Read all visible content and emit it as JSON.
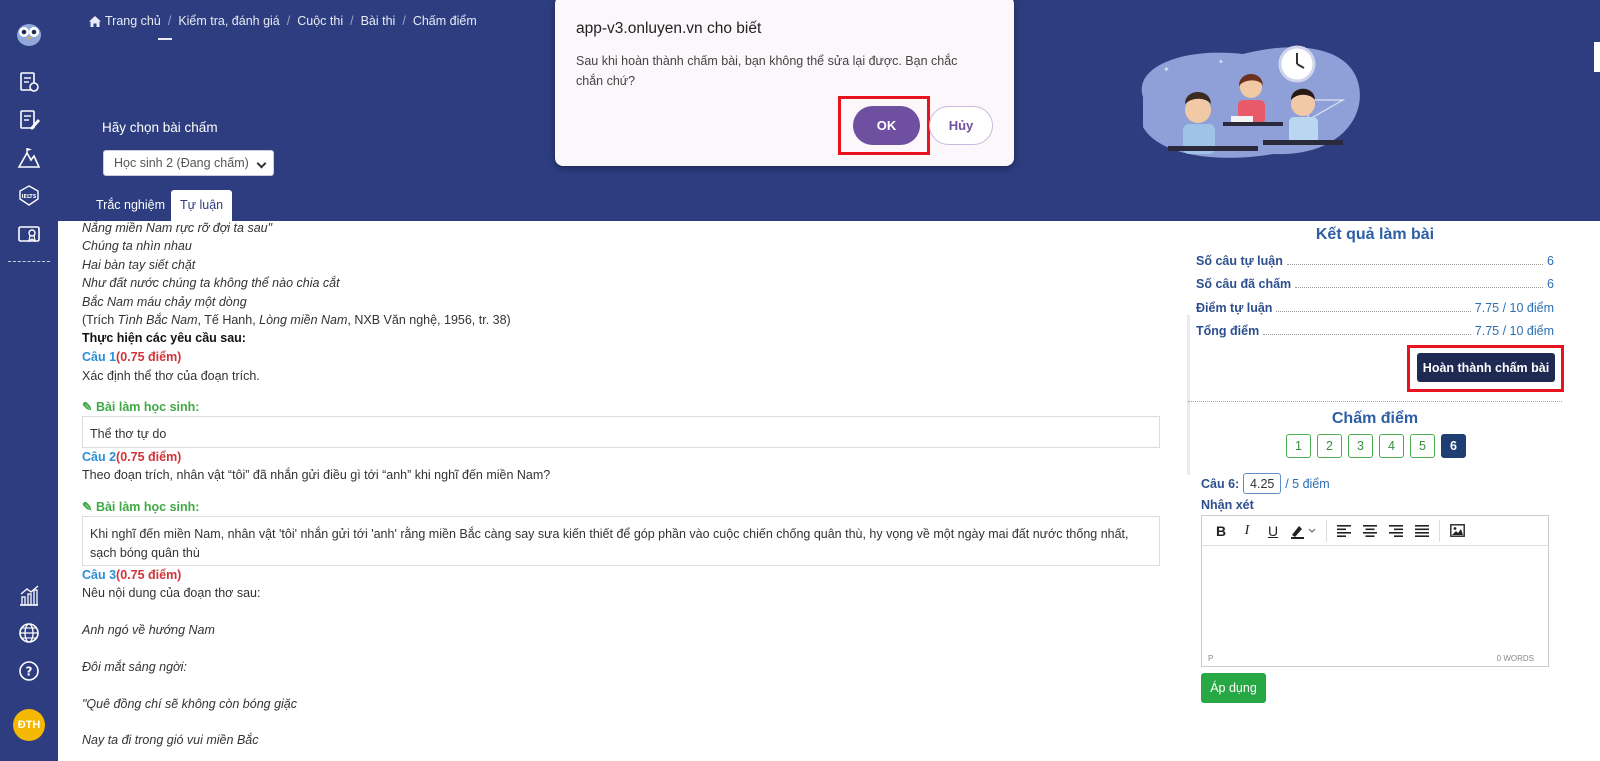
{
  "colors": {
    "nav": "#2d3d7f",
    "accent": "#2d5fa5",
    "ok": "#6f4fa0",
    "apply": "#28a745",
    "highlight": "#e8131e"
  },
  "sidebar": {
    "icons": [
      "logo-owl-icon",
      "exam-icon",
      "edit-doc-icon",
      "mountain-icon",
      "ielts-icon",
      "certificate-icon",
      "stats-icon",
      "globe-icon",
      "help-icon"
    ],
    "avatar": "ĐTH"
  },
  "breadcrumb": [
    {
      "label": "Trang chủ",
      "icon": "home-icon"
    },
    {
      "label": "Kiểm tra, đánh giá"
    },
    {
      "label": "Cuộc thi"
    },
    {
      "label": "Bài thi"
    },
    {
      "label": "Chấm điểm"
    }
  ],
  "header": {
    "choose_label": "Hãy chọn bài chấm",
    "student_select": "Học sinh 2 (Đang chấm)",
    "tabs": [
      "Trắc nghiệm",
      "Tự luận"
    ]
  },
  "content": {
    "poem": [
      "Nắng miền Nam rực rỡ đợi ta sau\"",
      "Chúng ta nhìn nhau",
      "Hai bàn tay siết chặt",
      "Như đất nước chúng ta không thể nào chia cắt",
      "Bắc Nam máu chảy một dòng"
    ],
    "citation": {
      "prefix": "(Trích ",
      "poem_title": "Tình Bắc Nam",
      "mid": ", Tế Hanh, ",
      "collection": "Lòng miền Nam",
      "suffix": ", NXB Văn nghệ, 1956, tr. 38)"
    },
    "requirements": "Thực hiện các yêu cầu sau:",
    "answer_label": "Bài làm học sinh:",
    "questions": [
      {
        "label": "Câu 1",
        "score": "(0.75 điểm)",
        "text": "Xác định thể thơ của đoạn trích.",
        "answer": "Thể thơ tự do"
      },
      {
        "label": "Câu 2",
        "score": "(0.75 điểm)",
        "text": "Theo đoạn trích, nhân vật “tôi” đã nhắn gửi điều gì tới “anh” khi nghĩ đến miền Nam?",
        "answer": "Khi nghĩ đến miền Nam, nhân vật 'tôi' nhắn gửi tới 'anh' rằng miền Bắc càng say sưa kiến thiết để góp phần vào cuộc chiến chống quân thù, hy vọng về một ngày mai đất nước thống nhất, sạch bóng quân thù"
      },
      {
        "label": "Câu 3",
        "score": "(0.75 điểm)",
        "text": "Nêu nội dung của đoạn thơ sau:"
      }
    ],
    "poem2": [
      "Anh ngó về hướng Nam",
      "Đôi mắt sáng ngời:",
      "\"Quê đồng chí sẽ không còn bóng giặc",
      "Nay ta đi trong gió vui miền Bắc"
    ]
  },
  "results": {
    "title": "Kết quả làm bài",
    "rows": [
      {
        "label": "Số câu tự luận",
        "value": "6"
      },
      {
        "label": "Số câu đã chấm",
        "value": "6"
      },
      {
        "label": "Điểm tự luận",
        "value": "7.75 / 10 điểm"
      },
      {
        "label": "Tổng điểm",
        "value": "7.75 / 10 điểm"
      }
    ],
    "finish_button": "Hoàn thành chấm bài"
  },
  "grading": {
    "title": "Chấm điểm",
    "question_numbers": [
      "1",
      "2",
      "3",
      "4",
      "5",
      "6"
    ],
    "active_question": "6",
    "score_label": "Câu 6:",
    "score_value": "4.25",
    "score_max": "/ 5 điểm",
    "comment_label": "Nhận xét",
    "editor_path": "P",
    "word_count": "0 WORDS",
    "apply_button": "Áp dụng"
  },
  "dialog": {
    "title": "app-v3.onluyen.vn cho biết",
    "message": "Sau khi hoàn thành chấm bài, bạn không thể sửa lại được. Bạn chắc chắn chứ?",
    "ok": "OK",
    "cancel": "Hủy"
  }
}
